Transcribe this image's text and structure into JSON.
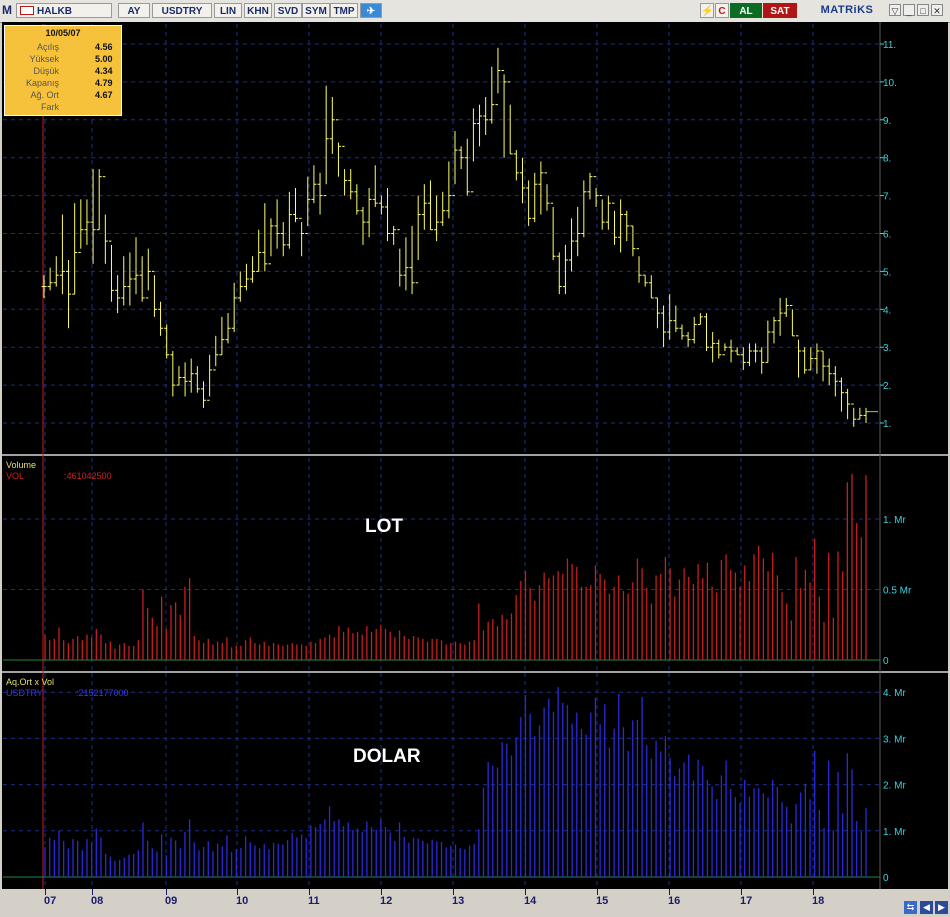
{
  "toolbar": {
    "logo": "M",
    "symbol": "HALKB",
    "buttons": [
      "AY",
      "USDTRY",
      "LIN",
      "KHN",
      "SVD",
      "SYM",
      "TMP"
    ],
    "al": "AL",
    "sat": "SAT",
    "brand": "MATRiKS"
  },
  "info_box": {
    "date": "10/05/07",
    "rows": [
      {
        "label": "Açılış",
        "value": "4.56"
      },
      {
        "label": "Yüksek",
        "value": "5.00"
      },
      {
        "label": "Düşük",
        "value": "4.34"
      },
      {
        "label": "Kapanış",
        "value": "4.79"
      },
      {
        "label": "Ağ. Ort",
        "value": "4.67"
      },
      {
        "label": "Fark",
        "value": ""
      }
    ]
  },
  "panels": {
    "volume_title": "Volume",
    "volume_series": "VOL",
    "volume_value": ":461042500",
    "volume_overlay": "LOT",
    "dollar_title": "Aq.Ort x Vol",
    "dollar_series": "USDTRY",
    "dollar_value": ":2152177000",
    "dollar_overlay": "DOLAR"
  },
  "colors": {
    "background": "#000000",
    "grid": "#1c2f8a",
    "price": "#ffff66",
    "volume": "#c81e1e",
    "dollar": "#2a2ad8",
    "axis_text": "#38d3e0",
    "marker": "#c81e1e"
  },
  "chart_data": [
    {
      "type": "bar",
      "subtype": "ohlc",
      "name": "price",
      "ylim": [
        0.6,
        11.3
      ],
      "yticks": [
        "1.",
        "2.",
        "3.",
        "4.",
        "5.",
        "6.",
        "7.",
        "8.",
        "9.",
        "10.",
        "11."
      ],
      "xticks": [
        "07",
        "08",
        "09",
        "10",
        "11",
        "12",
        "13",
        "14",
        "15",
        "16",
        "17",
        "18"
      ],
      "close": [
        4.6,
        4.7,
        4.9,
        5.0,
        4.4,
        5.5,
        6.1,
        6.3,
        6.1,
        7.5,
        5.8,
        4.5,
        4.3,
        4.6,
        4.8,
        4.9,
        4.3,
        5.0,
        4.0,
        3.5,
        2.8,
        2.0,
        2.2,
        2.1,
        2.3,
        1.9,
        1.6,
        2.4,
        2.8,
        3.2,
        3.5,
        4.3,
        4.6,
        4.8,
        5.0,
        5.5,
        5.2,
        6.2,
        6.0,
        5.7,
        6.5,
        6.4,
        6.0,
        6.9,
        7.3,
        7.0,
        8.5,
        9.0,
        8.3,
        7.4,
        7.1,
        6.6,
        6.3,
        6.9,
        6.8,
        6.7,
        6.0,
        6.1,
        4.9,
        5.1,
        4.7,
        6.5,
        6.8,
        6.1,
        6.3,
        6.6,
        7.0,
        8.2,
        8.0,
        7.1,
        8.9,
        9.1,
        9.0,
        9.4,
        10.3,
        10.0,
        8.1,
        7.6,
        7.2,
        6.4,
        7.3,
        7.6,
        6.8,
        5.4,
        4.6,
        5.3,
        5.8,
        6.0,
        7.1,
        7.5,
        7.0,
        6.3,
        6.8,
        5.9,
        6.5,
        6.2,
        5.6,
        4.9,
        4.7,
        4.3,
        3.9,
        3.4,
        3.7,
        3.5,
        3.3,
        3.2,
        3.6,
        3.8,
        3.0,
        3.1,
        2.8,
        3.0,
        2.9,
        2.8,
        2.6,
        2.9,
        2.9,
        2.6,
        3.4,
        3.7,
        3.9,
        4.1,
        3.3,
        2.9,
        2.4,
        2.7,
        2.9,
        2.5,
        2.3,
        2.1,
        1.8,
        1.5,
        1.1,
        1.2,
        1.3
      ],
      "high": [
        4.9,
        5.1,
        5.4,
        6.5,
        5.3,
        6.8,
        6.9,
        6.9,
        7.7,
        7.7,
        6.5,
        5.7,
        4.9,
        5.4,
        5.5,
        5.9,
        5.4,
        5.6,
        4.9,
        4.2,
        3.6,
        2.9,
        2.5,
        2.6,
        2.7,
        2.5,
        2.1,
        2.8,
        3.3,
        3.8,
        3.9,
        4.7,
        5.0,
        5.2,
        5.4,
        6.1,
        6.8,
        6.4,
        6.9,
        6.3,
        7.1,
        7.2,
        6.3,
        7.5,
        7.8,
        7.6,
        9.9,
        9.6,
        8.4,
        7.7,
        7.7,
        7.3,
        6.7,
        7.2,
        7.8,
        7.0,
        7.2,
        6.2,
        5.6,
        5.9,
        6.2,
        7.0,
        7.3,
        7.4,
        7.0,
        7.1,
        7.9,
        8.7,
        8.3,
        8.5,
        9.3,
        9.4,
        9.6,
        10.4,
        10.9,
        10.2,
        9.4,
        8.2,
        8.0,
        7.4,
        7.6,
        7.9,
        7.3,
        6.7,
        5.5,
        5.7,
        6.4,
        6.7,
        7.4,
        7.6,
        7.2,
        6.9,
        7.0,
        6.6,
        6.9,
        6.6,
        6.2,
        5.4,
        4.9,
        4.9,
        4.3,
        4.1,
        4.4,
        4.1,
        3.6,
        3.4,
        3.8,
        3.9,
        3.9,
        3.4,
        3.2,
        3.1,
        3.2,
        3.0,
        3.0,
        3.1,
        3.1,
        3.0,
        3.7,
        3.8,
        4.3,
        4.3,
        4.0,
        3.2,
        3.0,
        3.0,
        3.1,
        2.9,
        2.7,
        2.5,
        2.2,
        1.9,
        1.4,
        1.4,
        1.4
      ],
      "low": [
        4.3,
        4.5,
        4.6,
        4.4,
        3.5,
        4.4,
        5.6,
        5.7,
        5.2,
        6.1,
        5.2,
        4.2,
        3.9,
        4.1,
        4.1,
        4.4,
        4.2,
        4.5,
        3.8,
        3.3,
        2.7,
        1.7,
        2.0,
        1.7,
        1.8,
        1.8,
        1.4,
        1.7,
        2.5,
        2.8,
        3.1,
        3.4,
        4.2,
        4.5,
        4.7,
        5.0,
        5.0,
        5.4,
        5.6,
        5.4,
        5.6,
        6.3,
        5.4,
        6.2,
        6.8,
        6.5,
        7.3,
        8.1,
        7.5,
        7.0,
        6.9,
        6.5,
        5.7,
        5.9,
        6.7,
        6.5,
        5.8,
        5.7,
        4.6,
        4.5,
        4.4,
        5.3,
        6.1,
        6.1,
        5.8,
        6.2,
        6.4,
        7.3,
        7.7,
        7.0,
        7.9,
        8.3,
        8.6,
        8.9,
        9.7,
        8.0,
        8.1,
        7.4,
        6.8,
        6.2,
        6.3,
        6.5,
        6.6,
        5.3,
        4.4,
        4.4,
        5.0,
        5.4,
        5.9,
        6.9,
        6.7,
        6.1,
        6.1,
        5.7,
        5.5,
        5.8,
        5.4,
        4.7,
        4.6,
        4.3,
        3.5,
        3.0,
        3.2,
        3.4,
        3.2,
        3.0,
        3.1,
        3.6,
        2.9,
        2.6,
        2.7,
        2.9,
        2.6,
        2.8,
        2.4,
        2.5,
        2.6,
        2.3,
        2.6,
        3.1,
        3.3,
        3.8,
        3.3,
        2.2,
        2.3,
        2.4,
        2.3,
        2.1,
        2.0,
        1.7,
        1.3,
        1.1,
        0.9,
        1.1,
        1.0
      ]
    },
    {
      "type": "bar",
      "name": "VOL",
      "units": "Mr",
      "ylim": [
        0,
        1.35
      ],
      "yticks": [
        "0",
        "0.5 Mr",
        "1. Mr"
      ],
      "values": [
        0.18,
        0.14,
        0.15,
        0.23,
        0.14,
        0.12,
        0.15,
        0.17,
        0.14,
        0.18,
        0.16,
        0.22,
        0.18,
        0.12,
        0.13,
        0.08,
        0.11,
        0.12,
        0.1,
        0.1,
        0.14,
        0.5,
        0.37,
        0.3,
        0.24,
        0.45,
        0.22,
        0.39,
        0.41,
        0.32,
        0.52,
        0.58,
        0.17,
        0.14,
        0.12,
        0.15,
        0.11,
        0.13,
        0.12,
        0.16,
        0.09,
        0.1,
        0.1,
        0.14,
        0.16,
        0.12,
        0.11,
        0.13,
        0.1,
        0.12,
        0.11,
        0.1,
        0.11,
        0.12,
        0.11,
        0.11,
        0.1,
        0.13,
        0.12,
        0.15,
        0.16,
        0.18,
        0.16,
        0.24,
        0.2,
        0.23,
        0.19,
        0.2,
        0.18,
        0.24,
        0.2,
        0.22,
        0.25,
        0.22,
        0.2,
        0.16,
        0.21,
        0.17,
        0.15,
        0.17,
        0.16,
        0.15,
        0.13,
        0.15,
        0.15,
        0.14,
        0.11,
        0.12,
        0.13,
        0.12,
        0.11,
        0.13,
        0.14,
        0.4,
        0.21,
        0.27,
        0.29,
        0.24,
        0.32,
        0.29,
        0.33,
        0.46,
        0.56,
        0.63,
        0.51,
        0.42,
        0.53,
        0.62,
        0.58,
        0.6,
        0.63,
        0.61,
        0.72,
        0.68,
        0.66,
        0.52,
        0.52,
        0.53,
        0.67,
        0.61,
        0.57,
        0.47,
        0.52,
        0.6,
        0.49,
        0.47,
        0.55,
        0.72,
        0.65,
        0.51,
        0.4,
        0.6,
        0.61,
        0.73,
        0.65,
        0.45,
        0.57,
        0.65,
        0.59,
        0.54,
        0.68,
        0.58,
        0.69,
        0.52,
        0.48,
        0.71,
        0.75,
        0.64,
        0.62,
        0.52,
        0.67,
        0.56,
        0.75,
        0.81,
        0.72,
        0.63,
        0.76,
        0.6,
        0.48,
        0.4,
        0.28,
        0.73,
        0.51,
        0.64,
        0.55,
        0.86,
        0.45,
        0.27,
        0.76,
        0.3,
        0.77,
        0.63,
        1.26,
        1.32,
        0.97,
        0.87,
        1.31
      ],
      "series_value": ":461042500"
    },
    {
      "type": "bar",
      "name": "USDTRY",
      "units": "Mr",
      "ylim": [
        0,
        4.2
      ],
      "yticks": [
        "0",
        "1. Mr",
        "2. Mr",
        "3. Mr",
        "4. Mr"
      ],
      "values": [
        0.65,
        0.85,
        0.8,
        1.0,
        0.78,
        0.62,
        0.82,
        0.78,
        0.58,
        0.82,
        0.74,
        1.05,
        0.85,
        0.5,
        0.44,
        0.35,
        0.37,
        0.42,
        0.48,
        0.5,
        0.58,
        1.18,
        0.78,
        0.62,
        0.55,
        0.92,
        0.47,
        0.85,
        0.79,
        0.62,
        0.98,
        1.25,
        0.75,
        0.58,
        0.65,
        0.77,
        0.56,
        0.72,
        0.66,
        0.9,
        0.54,
        0.6,
        0.63,
        0.88,
        0.75,
        0.68,
        0.62,
        0.71,
        0.6,
        0.74,
        0.72,
        0.7,
        0.8,
        0.95,
        0.86,
        0.92,
        0.84,
        1.12,
        1.08,
        1.15,
        1.25,
        1.53,
        1.21,
        1.25,
        1.1,
        1.18,
        1.02,
        1.05,
        0.98,
        1.2,
        1.08,
        1.02,
        1.25,
        1.08,
        0.96,
        0.78,
        1.18,
        0.87,
        0.74,
        0.85,
        0.83,
        0.78,
        0.73,
        0.81,
        0.77,
        0.76,
        0.64,
        0.68,
        0.7,
        0.62,
        0.6,
        0.68,
        0.72,
        1.03,
        1.93,
        2.49,
        2.41,
        2.37,
        2.92,
        2.89,
        2.63,
        3.02,
        3.46,
        3.94,
        3.53,
        3.05,
        3.28,
        3.67,
        3.86,
        3.58,
        4.11,
        3.77,
        3.72,
        3.32,
        3.56,
        3.2,
        3.08,
        3.56,
        3.88,
        3.31,
        3.74,
        2.8,
        3.21,
        3.96,
        3.24,
        2.73,
        3.39,
        3.4,
        3.9,
        2.85,
        2.56,
        2.95,
        2.72,
        3.05,
        2.58,
        2.18,
        2.35,
        2.48,
        2.65,
        2.09,
        2.54,
        2.4,
        2.1,
        1.96,
        1.69,
        2.2,
        2.52,
        1.91,
        1.73,
        1.6,
        2.1,
        1.74,
        1.92,
        1.92,
        1.81,
        1.72,
        2.1,
        1.95,
        1.62,
        1.52,
        1.16,
        1.58,
        1.83,
        2.02,
        1.68,
        2.73,
        1.45,
        1.06,
        2.52,
        1.01,
        2.27,
        1.38,
        2.68,
        2.33,
        1.21,
        0.98,
        1.49
      ],
      "series_value": ":2152177000"
    }
  ]
}
